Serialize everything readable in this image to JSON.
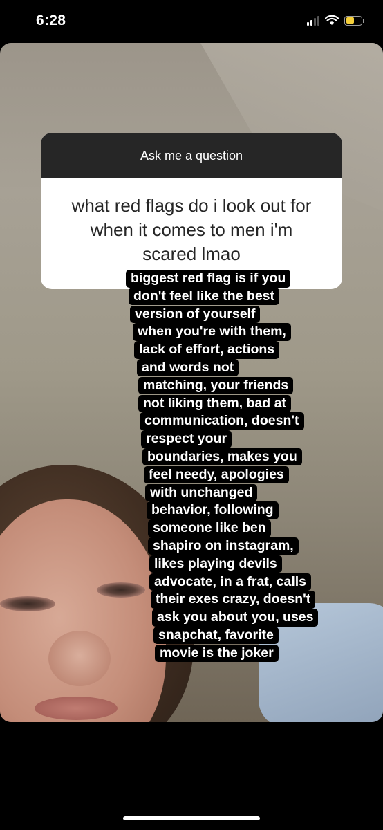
{
  "status_bar": {
    "time": "6:28",
    "battery_level": 0.55,
    "battery_color": "#f5cf3a",
    "signal_bars_active": 2,
    "icons": [
      "cellular-signal-icon",
      "wifi-icon",
      "battery-icon"
    ]
  },
  "question_sticker": {
    "header": "Ask me a question",
    "question_lines": [
      "what red flags do i look out for",
      "when it comes to men i'm",
      "scared lmao"
    ]
  },
  "answer": {
    "lines": [
      "biggest red flag is if you",
      "don't feel like the best",
      "version of yourself",
      "when you're with them,",
      "lack of effort, actions",
      "and words not",
      "matching, your friends",
      "not liking them, bad at",
      "communication, doesn't",
      "respect your",
      "boundaries,  makes you",
      "feel needy, apologies",
      "with unchanged",
      "behavior, following",
      "someone like ben",
      "shapiro on instagram,",
      "likes playing devils",
      "advocate, in a frat, calls",
      "their exes crazy, doesn't",
      "ask you about you, uses",
      "snapchat, favorite",
      "movie is the joker"
    ]
  }
}
